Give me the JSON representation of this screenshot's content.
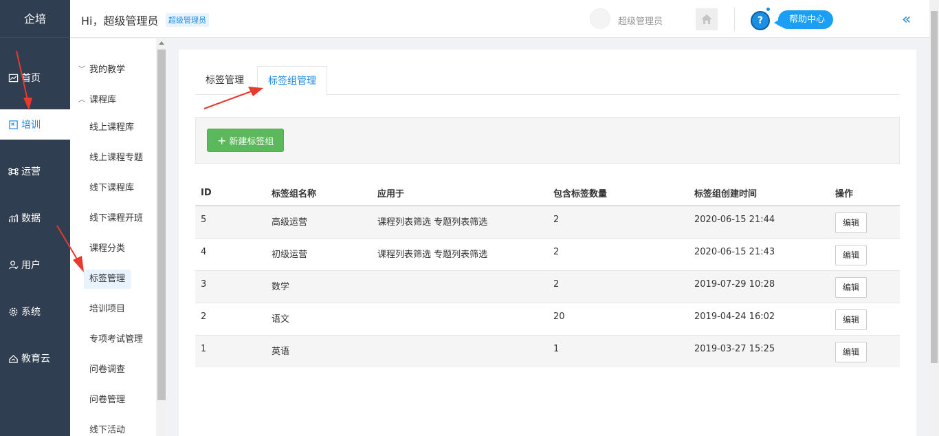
{
  "brand": "企培",
  "nav": {
    "items": [
      {
        "label": "首页",
        "icon": "chart-icon"
      },
      {
        "label": "培训",
        "icon": "training-icon"
      },
      {
        "label": "运营",
        "icon": "command-icon"
      },
      {
        "label": "数据",
        "icon": "bar-chart-icon"
      },
      {
        "label": "用户",
        "icon": "user-icon"
      },
      {
        "label": "系统",
        "icon": "gear-icon"
      },
      {
        "label": "教育云",
        "icon": "cloud-icon"
      }
    ],
    "active": "培训"
  },
  "header": {
    "greeting": "Hi，超级管理员",
    "role_badge": "超级管理员",
    "user_name": "超级管理员",
    "help_label": "帮助中心",
    "help_icon_text": "?",
    "collapse_icon": "«"
  },
  "submenu": {
    "groups": [
      {
        "label": "我的教学",
        "expanded": false
      },
      {
        "label": "课程库",
        "expanded": true
      }
    ],
    "items": [
      "线上课程库",
      "线上课程专题",
      "线下课程库",
      "线下课程开班",
      "课程分类",
      "标签管理",
      "培训项目",
      "专项考试管理",
      "问卷调查",
      "问卷管理",
      "线下活动"
    ],
    "active": "标签管理"
  },
  "tabs": [
    "标签管理",
    "标签组管理"
  ],
  "active_tab": "标签组管理",
  "toolbar": {
    "new_label": "新建标签组",
    "plus": "+"
  },
  "table": {
    "columns": [
      "ID",
      "标签组名称",
      "应用于",
      "包含标签数量",
      "标签组创建时间",
      "操作"
    ],
    "rows": [
      {
        "id": "5",
        "name": "高级运营",
        "applies": "课程列表筛选 专题列表筛选",
        "count": "2",
        "created": "2020-06-15 21:44",
        "action": "编辑"
      },
      {
        "id": "4",
        "name": "初级运营",
        "applies": "课程列表筛选 专题列表筛选",
        "count": "2",
        "created": "2020-06-15 21:43",
        "action": "编辑"
      },
      {
        "id": "3",
        "name": "数学",
        "applies": "",
        "count": "2",
        "created": "2019-07-29 10:28",
        "action": "编辑"
      },
      {
        "id": "2",
        "name": "语文",
        "applies": "",
        "count": "20",
        "created": "2019-04-24 16:02",
        "action": "编辑"
      },
      {
        "id": "1",
        "name": "英语",
        "applies": "",
        "count": "1",
        "created": "2019-03-27 15:25",
        "action": "编辑"
      }
    ]
  },
  "colors": {
    "sidebar": "#2f3e50",
    "accent": "#1e88e5",
    "success": "#5cb85c",
    "annotation": "#e8392c"
  }
}
